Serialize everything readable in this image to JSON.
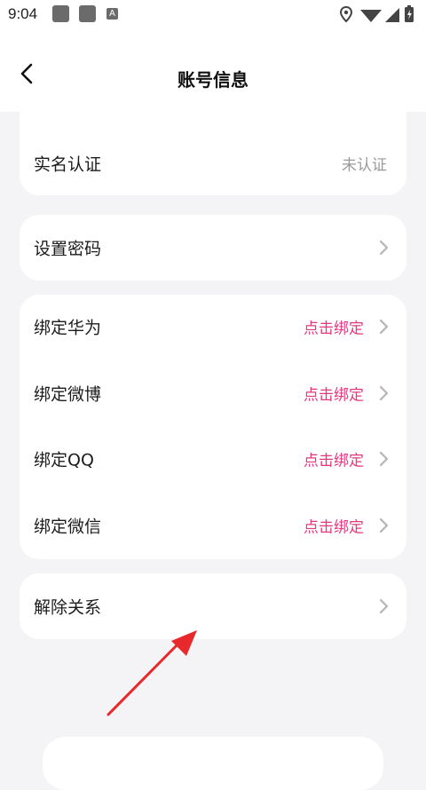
{
  "status_bar": {
    "time": "9:04",
    "a_badge": "A"
  },
  "header": {
    "title": "账号信息",
    "back_icon": "back-chevron-icon"
  },
  "real_name": {
    "label": "实名认证",
    "value": "未认证"
  },
  "password": {
    "label": "设置密码"
  },
  "bindings": [
    {
      "label": "绑定华为",
      "action": "点击绑定"
    },
    {
      "label": "绑定微博",
      "action": "点击绑定"
    },
    {
      "label": "绑定QQ",
      "action": "点击绑定"
    },
    {
      "label": "绑定微信",
      "action": "点击绑定"
    }
  ],
  "unbind": {
    "label": "解除关系"
  },
  "colors": {
    "accent": "#e4387e",
    "annotation_arrow": "#e8292b",
    "background": "#f4f4f6"
  }
}
